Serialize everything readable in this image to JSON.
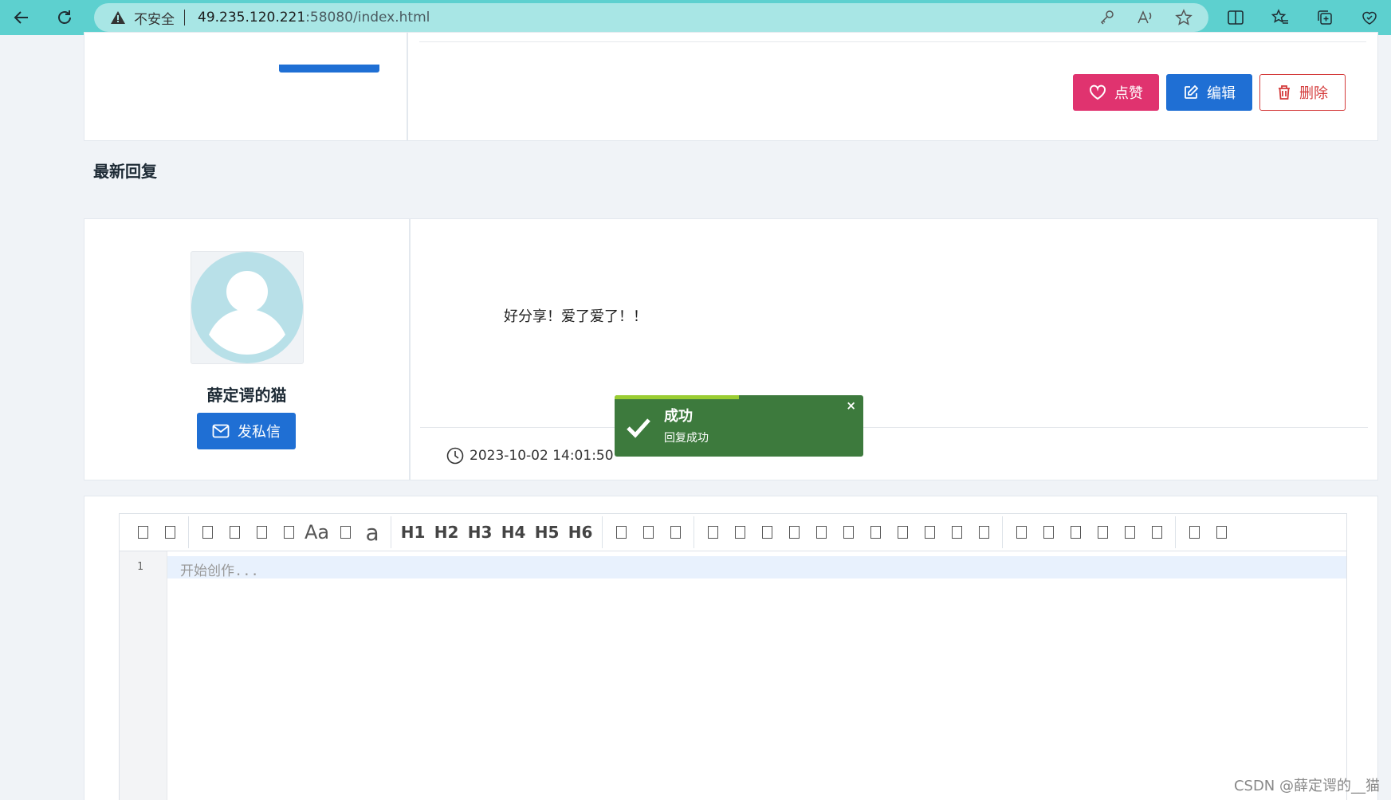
{
  "browser": {
    "insecure_label": "不安全",
    "url_host": "49.235.120.221",
    "url_rest": ":58080/index.html"
  },
  "post_actions": {
    "like_label": "点赞",
    "edit_label": "编辑",
    "delete_label": "删除"
  },
  "replies": {
    "section_title": "最新回复",
    "items": [
      {
        "username": "薛定谔的猫",
        "pm_label": "发私信",
        "content": "好分享！爱了爱了！！",
        "time": "2023-10-02 14:01:50"
      }
    ]
  },
  "toast": {
    "title": "成功",
    "message": "回复成功",
    "close": "×",
    "progress": 0.5,
    "color": "#3d7a3d"
  },
  "editor": {
    "toolbar": {
      "aa": "Aa",
      "a": "a",
      "headings": [
        "H1",
        "H2",
        "H3",
        "H4",
        "H5",
        "H6"
      ]
    },
    "line_number": "1",
    "placeholder": "开始创作..."
  },
  "watermark": "CSDN @薛定谔的__猫",
  "colors": {
    "primary": "#1f6fd4",
    "like": "#e0336f",
    "danger": "#d43b3b",
    "browser_bar": "#5dd0cf"
  }
}
